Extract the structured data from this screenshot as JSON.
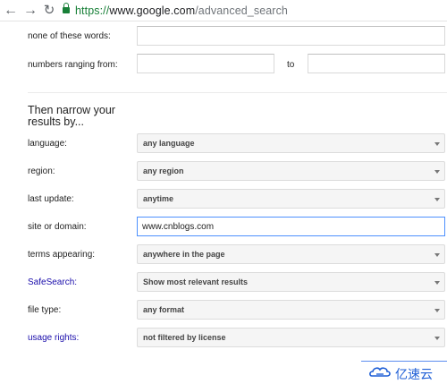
{
  "browser": {
    "url_scheme": "https://",
    "url_host": "www.google.com",
    "url_path": "/advanced_search",
    "back_glyph": "←",
    "forward_glyph": "→",
    "reload_glyph": "↻"
  },
  "top_fields": {
    "none_words_label": "none of these words:",
    "numbers_label": "numbers ranging from:",
    "to_label": "to"
  },
  "narrow": {
    "title": "Then narrow your results by...",
    "rows": [
      {
        "label": "language:",
        "value": "any language"
      },
      {
        "label": "region:",
        "value": "any region"
      },
      {
        "label": "last update:",
        "value": "anytime"
      },
      {
        "label": "site or domain:",
        "value": "www.cnblogs.com"
      },
      {
        "label": "terms appearing:",
        "value": "anywhere in the page"
      },
      {
        "label": "SafeSearch:",
        "value": "Show most relevant results"
      },
      {
        "label": "file type:",
        "value": "any format"
      },
      {
        "label": "usage rights:",
        "value": "not filtered by license"
      }
    ]
  },
  "watermark": {
    "text": "亿速云"
  },
  "colors": {
    "link": "#1a0dab",
    "secure": "#188038",
    "focus_border": "#4d90fe"
  }
}
